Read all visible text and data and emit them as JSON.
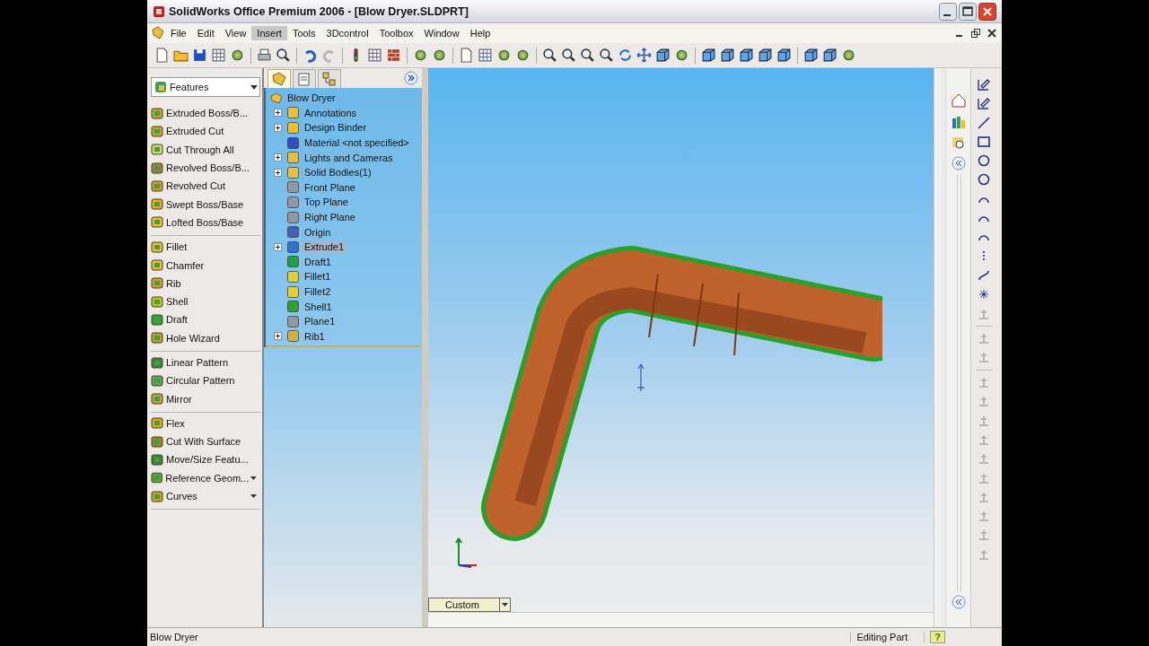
{
  "window": {
    "title": "SolidWorks Office Premium 2006 - [Blow Dryer.SLDPRT]"
  },
  "menu": [
    {
      "label": "File",
      "selected": false
    },
    {
      "label": "Edit",
      "selected": false
    },
    {
      "label": "View",
      "selected": false
    },
    {
      "label": "Insert",
      "selected": true
    },
    {
      "label": "Tools",
      "selected": false
    },
    {
      "label": "3Dcontrol",
      "selected": false
    },
    {
      "label": "Toolbox",
      "selected": false
    },
    {
      "label": "Window",
      "selected": false
    },
    {
      "label": "Help",
      "selected": false
    }
  ],
  "command_manager": {
    "selector": "Features",
    "groups": [
      [
        {
          "label": "Extruded Boss/B...",
          "dropdown": false
        },
        {
          "label": "Extruded Cut",
          "dropdown": false
        },
        {
          "label": "Cut Through All",
          "dropdown": false
        },
        {
          "label": "Revolved Boss/B...",
          "dropdown": false
        },
        {
          "label": "Revolved Cut",
          "dropdown": false
        },
        {
          "label": "Swept Boss/Base",
          "dropdown": false
        },
        {
          "label": "Lofted Boss/Base",
          "dropdown": false
        }
      ],
      [
        {
          "label": "Fillet",
          "dropdown": false
        },
        {
          "label": "Chamfer",
          "dropdown": false
        },
        {
          "label": "Rib",
          "dropdown": false
        },
        {
          "label": "Shell",
          "dropdown": false
        },
        {
          "label": "Draft",
          "dropdown": false
        },
        {
          "label": "Hole Wizard",
          "dropdown": false
        }
      ],
      [
        {
          "label": "Linear Pattern",
          "dropdown": false
        },
        {
          "label": "Circular Pattern",
          "dropdown": false
        },
        {
          "label": "Mirror",
          "dropdown": false
        }
      ],
      [
        {
          "label": "Flex",
          "dropdown": false
        },
        {
          "label": "Cut With Surface",
          "dropdown": false
        },
        {
          "label": "Move/Size Featu...",
          "dropdown": false
        },
        {
          "label": "Reference Geom...",
          "dropdown": true
        },
        {
          "label": "Curves",
          "dropdown": true
        }
      ]
    ]
  },
  "feature_tree": {
    "root": "Blow Dryer",
    "items": [
      {
        "label": "Annotations",
        "expandable": true,
        "selected": false
      },
      {
        "label": "Design Binder",
        "expandable": true,
        "selected": false
      },
      {
        "label": "Material <not specified>",
        "expandable": false,
        "selected": false
      },
      {
        "label": "Lights and Cameras",
        "expandable": true,
        "selected": false
      },
      {
        "label": "Solid Bodies(1)",
        "expandable": true,
        "selected": false
      },
      {
        "label": "Front Plane",
        "expandable": false,
        "selected": false
      },
      {
        "label": "Top Plane",
        "expandable": false,
        "selected": false
      },
      {
        "label": "Right Plane",
        "expandable": false,
        "selected": false
      },
      {
        "label": "Origin",
        "expandable": false,
        "selected": false
      },
      {
        "label": "Extrude1",
        "expandable": true,
        "selected": true
      },
      {
        "label": "Draft1",
        "expandable": false,
        "selected": false
      },
      {
        "label": "Fillet1",
        "expandable": false,
        "selected": false
      },
      {
        "label": "Fillet2",
        "expandable": false,
        "selected": false
      },
      {
        "label": "Shell1",
        "expandable": false,
        "selected": false
      },
      {
        "label": "Plane1",
        "expandable": false,
        "selected": false
      },
      {
        "label": "Rib1",
        "expandable": true,
        "selected": false
      }
    ]
  },
  "viewport": {
    "view_selector": "Custom"
  },
  "status_bar": {
    "left": "Blow Dryer",
    "mode": "Editing Part",
    "help": "?"
  }
}
